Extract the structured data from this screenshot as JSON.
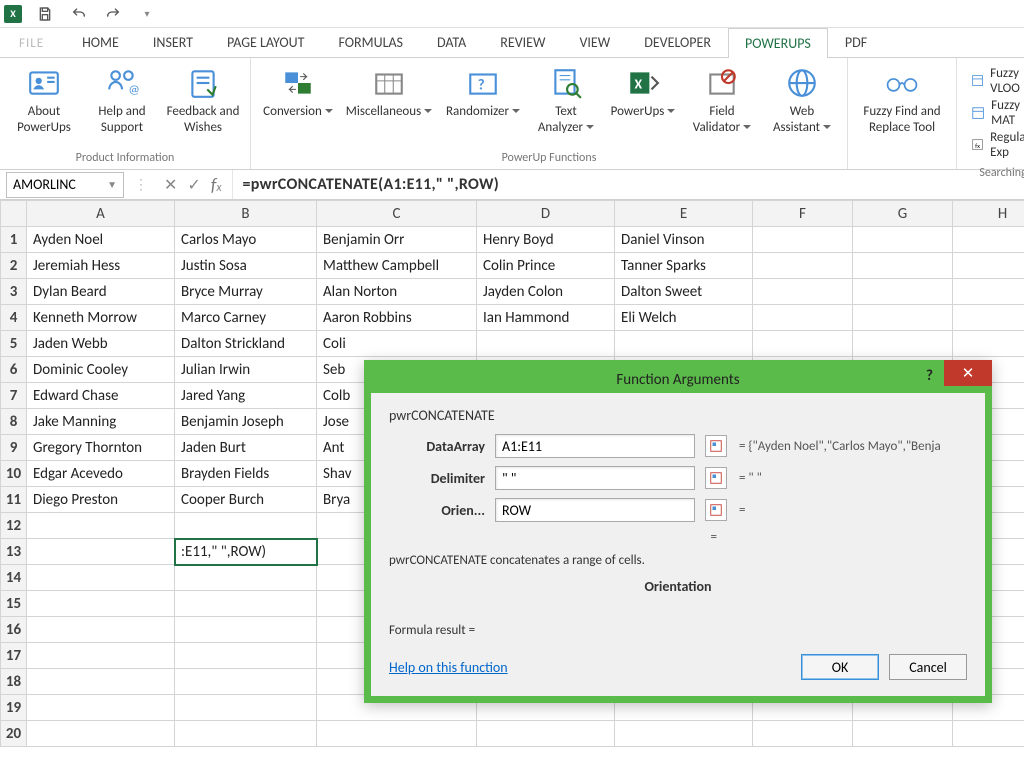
{
  "qat": {
    "app_label": "X"
  },
  "tabs": {
    "file": "FILE",
    "items": [
      "HOME",
      "INSERT",
      "PAGE LAYOUT",
      "FORMULAS",
      "DATA",
      "REVIEW",
      "VIEW",
      "DEVELOPER",
      "POWERUPS",
      "PDF"
    ],
    "active_index": 8
  },
  "ribbon": {
    "groups": [
      {
        "label": "Product Information",
        "items": [
          {
            "name": "about-powerups",
            "label": "About PowerUps",
            "icon": "user-card-icon"
          },
          {
            "name": "help-support",
            "label": "Help and Support",
            "icon": "support-icon"
          },
          {
            "name": "feedback-wishes",
            "label": "Feedback and Wishes",
            "icon": "feedback-icon"
          }
        ]
      },
      {
        "label": "PowerUp Functions",
        "items": [
          {
            "name": "conversion",
            "label": "Conversion",
            "icon": "conversion-icon",
            "dropdown": true
          },
          {
            "name": "miscellaneous",
            "label": "Miscellaneous",
            "icon": "misc-icon",
            "dropdown": true
          },
          {
            "name": "randomizer",
            "label": "Randomizer",
            "icon": "randomizer-icon",
            "dropdown": true
          },
          {
            "name": "text-analyzer",
            "label": "Text Analyzer",
            "icon": "text-analyzer-icon",
            "dropdown": true
          },
          {
            "name": "powerups",
            "label": "PowerUps",
            "icon": "powerups-icon",
            "dropdown": true
          },
          {
            "name": "field-validator",
            "label": "Field Validator",
            "icon": "validator-icon",
            "dropdown": true
          },
          {
            "name": "web-assistant",
            "label": "Web Assistant",
            "icon": "web-icon",
            "dropdown": true
          }
        ]
      },
      {
        "label": "",
        "items": [
          {
            "name": "fuzzy-find-replace",
            "label": "Fuzzy Find and Replace Tool",
            "icon": "glasses-icon"
          }
        ]
      },
      {
        "label": "Searching",
        "small_items": [
          {
            "name": "fuzzy-vlookup",
            "label": "Fuzzy VLOO",
            "icon": "sheet-icon"
          },
          {
            "name": "fuzzy-match",
            "label": "Fuzzy MAT",
            "icon": "sheet-icon"
          },
          {
            "name": "regular-exp",
            "label": "Regular Exp",
            "icon": "sheet-icon"
          }
        ]
      }
    ]
  },
  "formula_bar": {
    "namebox": "AMORLINC",
    "formula": "=pwrCONCATENATE(A1:E11,\" \",ROW)"
  },
  "columns": [
    "A",
    "B",
    "C",
    "D",
    "E",
    "F",
    "G",
    "H"
  ],
  "rows": [
    [
      "Ayden Noel",
      "Carlos Mayo",
      "Benjamin Orr",
      "Henry Boyd",
      "Daniel Vinson",
      "",
      "",
      ""
    ],
    [
      "Jeremiah Hess",
      "Justin Sosa",
      "Matthew Campbell",
      "Colin Prince",
      "Tanner Sparks",
      "",
      "",
      ""
    ],
    [
      "Dylan Beard",
      "Bryce Murray",
      "Alan Norton",
      "Jayden Colon",
      "Dalton Sweet",
      "",
      "",
      ""
    ],
    [
      "Kenneth Morrow",
      "Marco Carney",
      "Aaron Robbins",
      "Ian Hammond",
      "Eli Welch",
      "",
      "",
      ""
    ],
    [
      "Jaden Webb",
      "Dalton Strickland",
      "Coli",
      "",
      "",
      "",
      "",
      ""
    ],
    [
      "Dominic Cooley",
      "Julian Irwin",
      "Seb",
      "",
      "",
      "",
      "",
      ""
    ],
    [
      "Edward Chase",
      "Jared Yang",
      "Colb",
      "",
      "",
      "",
      "",
      ""
    ],
    [
      "Jake Manning",
      "Benjamin Joseph",
      "Jose",
      "",
      "",
      "",
      "",
      ""
    ],
    [
      "Gregory Thornton",
      "Jaden Burt",
      "Ant",
      "",
      "",
      "",
      "",
      ""
    ],
    [
      "Edgar Acevedo",
      "Brayden Fields",
      "Shav",
      "",
      "",
      "",
      "",
      ""
    ],
    [
      "Diego Preston",
      "Cooper Burch",
      "Brya",
      "",
      "",
      "",
      "",
      ""
    ],
    [
      "",
      "",
      "",
      "",
      "",
      "",
      "",
      ""
    ],
    [
      "",
      ":E11,\" \",ROW)",
      "",
      "",
      "",
      "",
      "",
      ""
    ],
    [
      "",
      "",
      "",
      "",
      "",
      "",
      "",
      ""
    ],
    [
      "",
      "",
      "",
      "",
      "",
      "",
      "",
      ""
    ],
    [
      "",
      "",
      "",
      "",
      "",
      "",
      "",
      ""
    ],
    [
      "",
      "",
      "",
      "",
      "",
      "",
      "",
      ""
    ],
    [
      "",
      "",
      "",
      "",
      "",
      "",
      "",
      ""
    ],
    [
      "",
      "",
      "",
      "",
      "",
      "",
      "",
      ""
    ],
    [
      "",
      "",
      "",
      "",
      "",
      "",
      "",
      ""
    ]
  ],
  "editing_cell": {
    "row_index": 12,
    "col_index": 1
  },
  "dialog": {
    "title": "Function Arguments",
    "function_name": "pwrCONCATENATE",
    "args": [
      {
        "label": "DataArray",
        "value": "A1:E11",
        "result": "= {\"Ayden Noel\",\"Carlos Mayo\",\"Benja"
      },
      {
        "label": "Delimiter",
        "value": "\" \"",
        "result": "= \" \""
      },
      {
        "label": "Orien...",
        "value": "ROW",
        "result": "="
      }
    ],
    "trailing_eq": "=",
    "description": "pwrCONCATENATE concatenates a range of cells.",
    "orientation_label": "Orientation",
    "result_label": "Formula result =",
    "help_link": "Help on this function",
    "ok": "OK",
    "cancel": "Cancel"
  }
}
